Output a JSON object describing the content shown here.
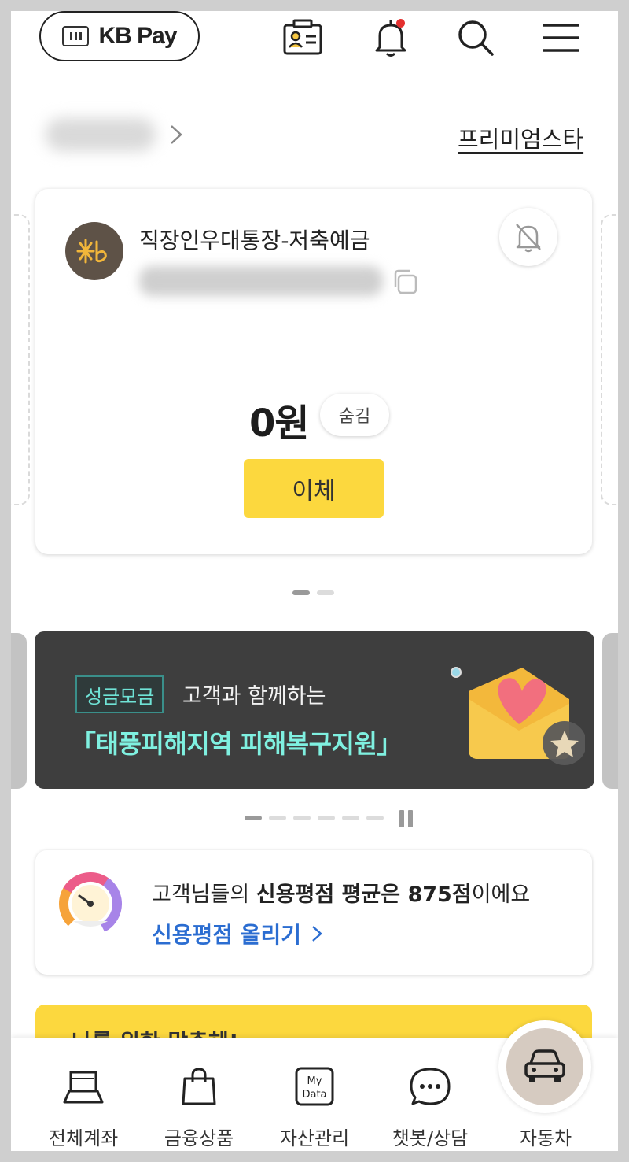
{
  "header": {
    "kbpay_label": "KB Pay",
    "notification_dot_color": "#e4302f",
    "icons": [
      "id-card-icon",
      "bell-icon",
      "search-icon",
      "menu-icon"
    ]
  },
  "user": {
    "premium_link": "프리미엄스타"
  },
  "account_card": {
    "account_name": "직장인우대통장-저축예금",
    "balance": "0원",
    "hide_label": "숨김",
    "transfer_label": "이체"
  },
  "banner": {
    "chip": "성금모금",
    "subtitle": "고객과 함께하는",
    "title": "「태풍피해지역 피해복구지원」"
  },
  "credit": {
    "text_prefix": "고객님들의 ",
    "text_bold": "신용평점 평균은 875점",
    "text_suffix": "이에요",
    "link": "신용평점 올리기"
  },
  "promo": {
    "partial_text": "나를 위한 맞춤혜!"
  },
  "bottom_nav": {
    "items": [
      {
        "label": "전체계좌",
        "icon": "laptop-icon"
      },
      {
        "label": "금융상품",
        "icon": "shopping-bag-icon"
      },
      {
        "label": "자산관리",
        "icon": "my-data-icon",
        "icon_text_top": "My",
        "icon_text_bottom": "Data"
      },
      {
        "label": "챗봇/상담",
        "icon": "chat-icon"
      },
      {
        "label": "자동차",
        "icon": "car-icon"
      }
    ]
  },
  "colors": {
    "accent_yellow": "#fcd83e",
    "link_blue": "#2b6dd1",
    "banner_bg": "#3e3e3e",
    "banner_title": "#7ff0e0"
  }
}
